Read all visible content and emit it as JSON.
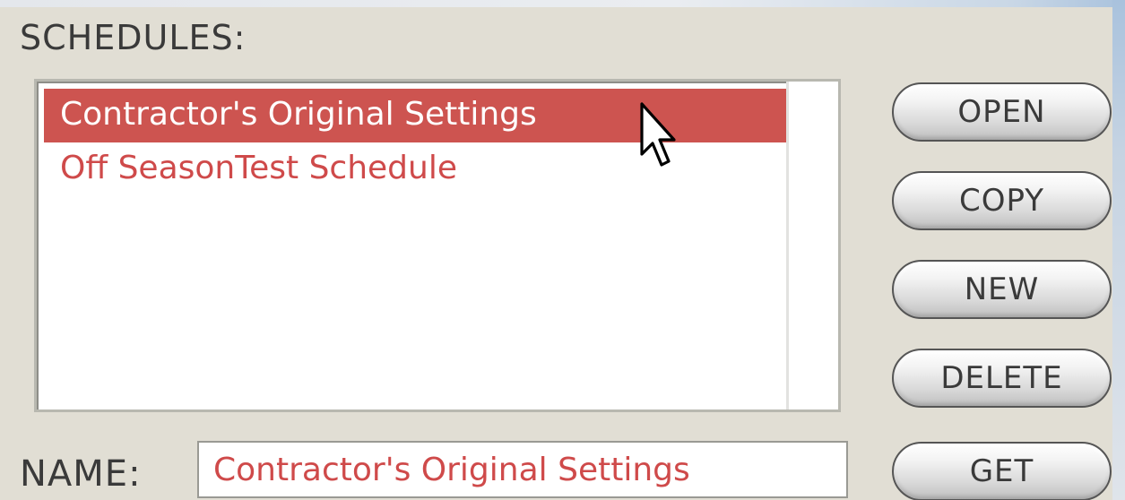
{
  "schedules": {
    "label": "SCHEDULES:",
    "items": [
      {
        "label": "Contractor's Original Settings",
        "selected": true
      },
      {
        "label": "Off SeasonTest Schedule",
        "selected": false
      }
    ]
  },
  "buttons": {
    "open": "OPEN",
    "copy": "COPY",
    "new": "NEW",
    "delete": "DELETE",
    "get": "GET"
  },
  "name": {
    "label": "NAME:",
    "value": "Contractor's Original Settings"
  },
  "colors": {
    "selection": "#cd5450",
    "item_text": "#cf4a4a",
    "panel": "#e1ded4"
  },
  "icons": {
    "pointer": "arrow-cursor-icon"
  }
}
